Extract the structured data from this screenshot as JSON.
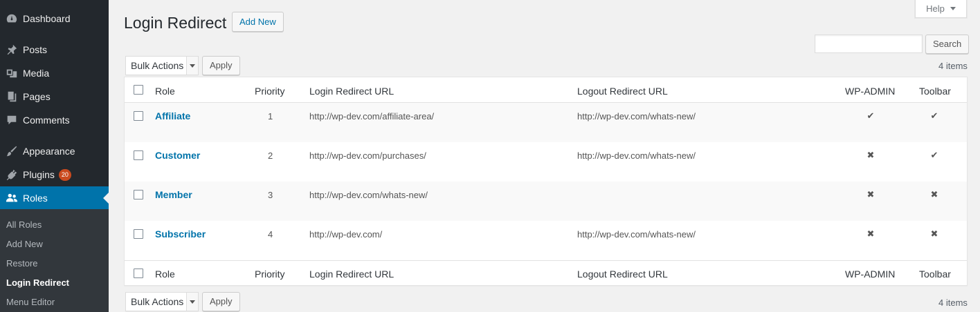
{
  "sidebar": {
    "items": [
      {
        "label": "Dashboard",
        "icon": "dashboard-icon"
      },
      {
        "label": "Posts",
        "icon": "pin-icon"
      },
      {
        "label": "Media",
        "icon": "media-icon"
      },
      {
        "label": "Pages",
        "icon": "pages-icon"
      },
      {
        "label": "Comments",
        "icon": "comment-icon"
      },
      {
        "label": "Appearance",
        "icon": "paintbrush-icon"
      },
      {
        "label": "Plugins",
        "icon": "plugin-icon",
        "badge": "20"
      },
      {
        "label": "Roles",
        "icon": "users-icon"
      }
    ],
    "submenu": [
      "All Roles",
      "Add New",
      "Restore",
      "Login Redirect",
      "Menu Editor"
    ]
  },
  "header": {
    "title": "Login Redirect",
    "add_new_label": "Add New",
    "help_label": "Help"
  },
  "search": {
    "value": "",
    "button_label": "Search"
  },
  "bulk": {
    "select_label": "Bulk Actions",
    "apply_label": "Apply"
  },
  "items_count": "4 items",
  "table": {
    "columns": [
      "Role",
      "Priority",
      "Login Redirect URL",
      "Logout Redirect URL",
      "WP-ADMIN",
      "Toolbar"
    ],
    "rows": [
      {
        "role": "Affiliate",
        "priority": "1",
        "login_url": "http://wp-dev.com/affiliate-area/",
        "logout_url": "http://wp-dev.com/whats-new/",
        "wp_admin": "✔",
        "toolbar": "✔"
      },
      {
        "role": "Customer",
        "priority": "2",
        "login_url": "http://wp-dev.com/purchases/",
        "logout_url": "http://wp-dev.com/whats-new/",
        "wp_admin": "✖",
        "toolbar": "✔"
      },
      {
        "role": "Member",
        "priority": "3",
        "login_url": "http://wp-dev.com/whats-new/",
        "logout_url": "",
        "wp_admin": "✖",
        "toolbar": "✖"
      },
      {
        "role": "Subscriber",
        "priority": "4",
        "login_url": "http://wp-dev.com/",
        "logout_url": "http://wp-dev.com/whats-new/",
        "wp_admin": "✖",
        "toolbar": "✖"
      }
    ]
  },
  "colors": {
    "sidebar_bg": "#23282d",
    "active_bg": "#0073aa",
    "link": "#0073aa",
    "badge": "#ca4a1f"
  }
}
